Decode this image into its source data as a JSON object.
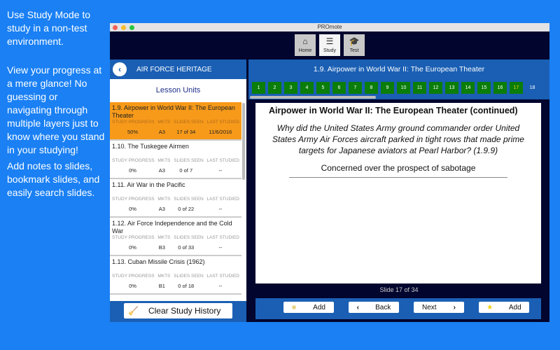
{
  "side_text": [
    "Use Study Mode to study in a non-test environment.",
    "View your progress at a mere glance!  No guessing or navigating through multiple layers just to know where you stand in your studying!",
    "Add notes to slides, bookmark slides, and easily search slides."
  ],
  "window": {
    "title": "PROmote"
  },
  "toolbar": [
    {
      "label": "Home",
      "icon": "home-icon"
    },
    {
      "label": "Study",
      "icon": "notepad-icon",
      "active": true
    },
    {
      "label": "Test",
      "icon": "graduation-cap-icon"
    }
  ],
  "left": {
    "header": "AIR FORCE HERITAGE",
    "subtitle": "Lesson Units",
    "clear_label": "Clear Study History",
    "columns": [
      "STUDY PROGRESS",
      "MKTS",
      "SLIDES SEEN",
      "LAST STUDIED"
    ],
    "units": [
      {
        "title": "1.9. Airpower in World War II: The European Theater",
        "progress": "50%",
        "mkts": "A3",
        "seen": "17 of 34",
        "last": "11/6/2016"
      },
      {
        "title": "1.10. The Tuskegee Airmen",
        "progress": "0%",
        "mkts": "A3",
        "seen": "0 of 7",
        "last": "--"
      },
      {
        "title": "1.11. Air War in the Pacific",
        "progress": "0%",
        "mkts": "A3",
        "seen": "0 of 22",
        "last": "--"
      },
      {
        "title": "1.12. Air Force Independence and the Cold War",
        "progress": "0%",
        "mkts": "B3",
        "seen": "0 of 33",
        "last": "--"
      },
      {
        "title": "1.13. Cuban Missile Crisis (1962)",
        "progress": "0%",
        "mkts": "B1",
        "seen": "0 of 18",
        "last": "--"
      }
    ]
  },
  "right": {
    "header": "1.9. Airpower in World War II: The European Theater",
    "slides": [
      "1",
      "2",
      "3",
      "4",
      "5",
      "6",
      "7",
      "8",
      "9",
      "10",
      "11",
      "12",
      "13",
      "14",
      "15",
      "16",
      "17",
      "18"
    ],
    "current_slide": "17",
    "card": {
      "title": "Airpower in World War II: The European Theater (continued)",
      "question": "Why did the United States Army ground commander order United States Army Air Forces aircraft parked in tight rows that made prime targets for Japanese aviators at Pearl Harbor? (1.9.9)",
      "answer": "Concerned over the prospect of sabotage"
    },
    "counter": "Slide 17 of 34",
    "buttons": {
      "add_note": "Add",
      "back": "Back",
      "next": "Next",
      "add_bookmark": "Add"
    }
  },
  "colors": {
    "background": "#1a80f4",
    "header": "#1a5fb4",
    "selected": "#f79a1a",
    "seen": "#0a7d0a"
  }
}
